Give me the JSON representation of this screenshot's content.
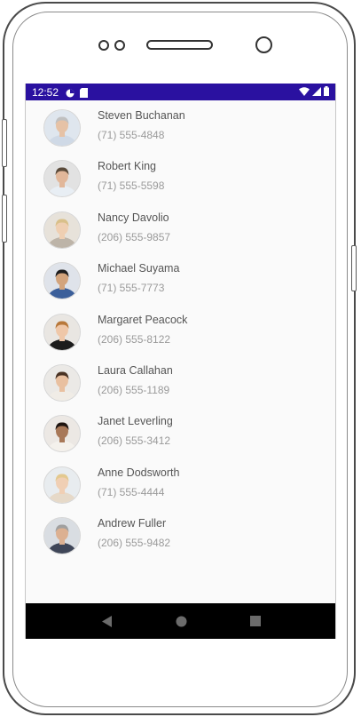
{
  "status_bar": {
    "time": "12:52",
    "background_color": "#2a11a0",
    "left_icons": [
      "circle-status-icon",
      "sd-card-icon"
    ],
    "right_icons": [
      "wifi-icon",
      "signal-icon",
      "battery-icon"
    ]
  },
  "contacts": [
    {
      "name": "Steven Buchanan",
      "phone": "(71) 555-4848",
      "avatar_bg": "#dfe6ee",
      "shirt": "#cfd9e6",
      "hair": "#c0c0c0",
      "skin": "#e6c2a6"
    },
    {
      "name": "Robert King",
      "phone": "(71) 555-5598",
      "avatar_bg": "#e2e2e2",
      "shirt": "#e8eef4",
      "hair": "#5a4a3a",
      "skin": "#e1b79a"
    },
    {
      "name": "Nancy Davolio",
      "phone": "(206) 555-9857",
      "avatar_bg": "#e7e2da",
      "shirt": "#bdb4a8",
      "hair": "#d9c08a",
      "skin": "#efcfb2"
    },
    {
      "name": "Michael Suyama",
      "phone": "(71) 555-7773",
      "avatar_bg": "#dfe3ea",
      "shirt": "#3b5f9a",
      "hair": "#1d1d1d",
      "skin": "#d3a47c"
    },
    {
      "name": "Margaret Peacock",
      "phone": "(206) 555-8122",
      "avatar_bg": "#e9e6e2",
      "shirt": "#1c1c1c",
      "hair": "#b8783a",
      "skin": "#efc7a8"
    },
    {
      "name": "Laura Callahan",
      "phone": "(206) 555-1189",
      "avatar_bg": "#ebe9e6",
      "shirt": "#f0ece6",
      "hair": "#4a3324",
      "skin": "#e9c0a0"
    },
    {
      "name": "Janet Leverling",
      "phone": "(206) 555-3412",
      "avatar_bg": "#ece8e4",
      "shirt": "#f4f1ec",
      "hair": "#1e1410",
      "skin": "#a87858"
    },
    {
      "name": "Anne Dodsworth",
      "phone": "(71) 555-4444",
      "avatar_bg": "#e8ecef",
      "shirt": "#e6d9c8",
      "hair": "#e3c98f",
      "skin": "#f0cfb4"
    },
    {
      "name": "Andrew Fuller",
      "phone": "(206) 555-9482",
      "avatar_bg": "#d9dde2",
      "shirt": "#3f4658",
      "hair": "#a0a0a0",
      "skin": "#dcb091"
    }
  ],
  "nav_bar": {
    "back": "back-triangle-icon",
    "home": "home-circle-icon",
    "recents": "recents-square-icon"
  }
}
